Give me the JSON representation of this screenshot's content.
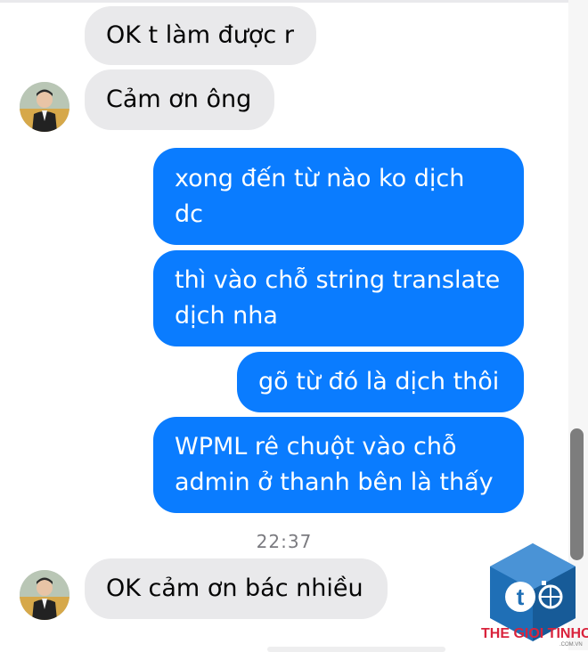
{
  "thread": {
    "messages": [
      {
        "text": "OK t làm được r"
      },
      {
        "text": "Cảm ơn ông"
      },
      {
        "text": "xong đến từ nào ko dịch\ndc"
      },
      {
        "text": "thì vào chỗ string translate\ndịch nha"
      },
      {
        "text": "gõ từ đó là dịch thôi"
      },
      {
        "text": "WPML rê chuột vào chỗ\nadmin ở thanh bên là thấy"
      },
      {
        "text": "OK cảm ơn bác nhiều"
      }
    ],
    "timestamp": "22:37"
  },
  "watermark": {
    "brand": "THE GIOI TINHOC",
    "domain": ".COM.VN",
    "colors": {
      "red": "#d9233c",
      "blue": "#1f6fb6"
    }
  },
  "colors": {
    "incoming_bubble": "#e9e9eb",
    "outgoing_bubble": "#0a7cff"
  }
}
